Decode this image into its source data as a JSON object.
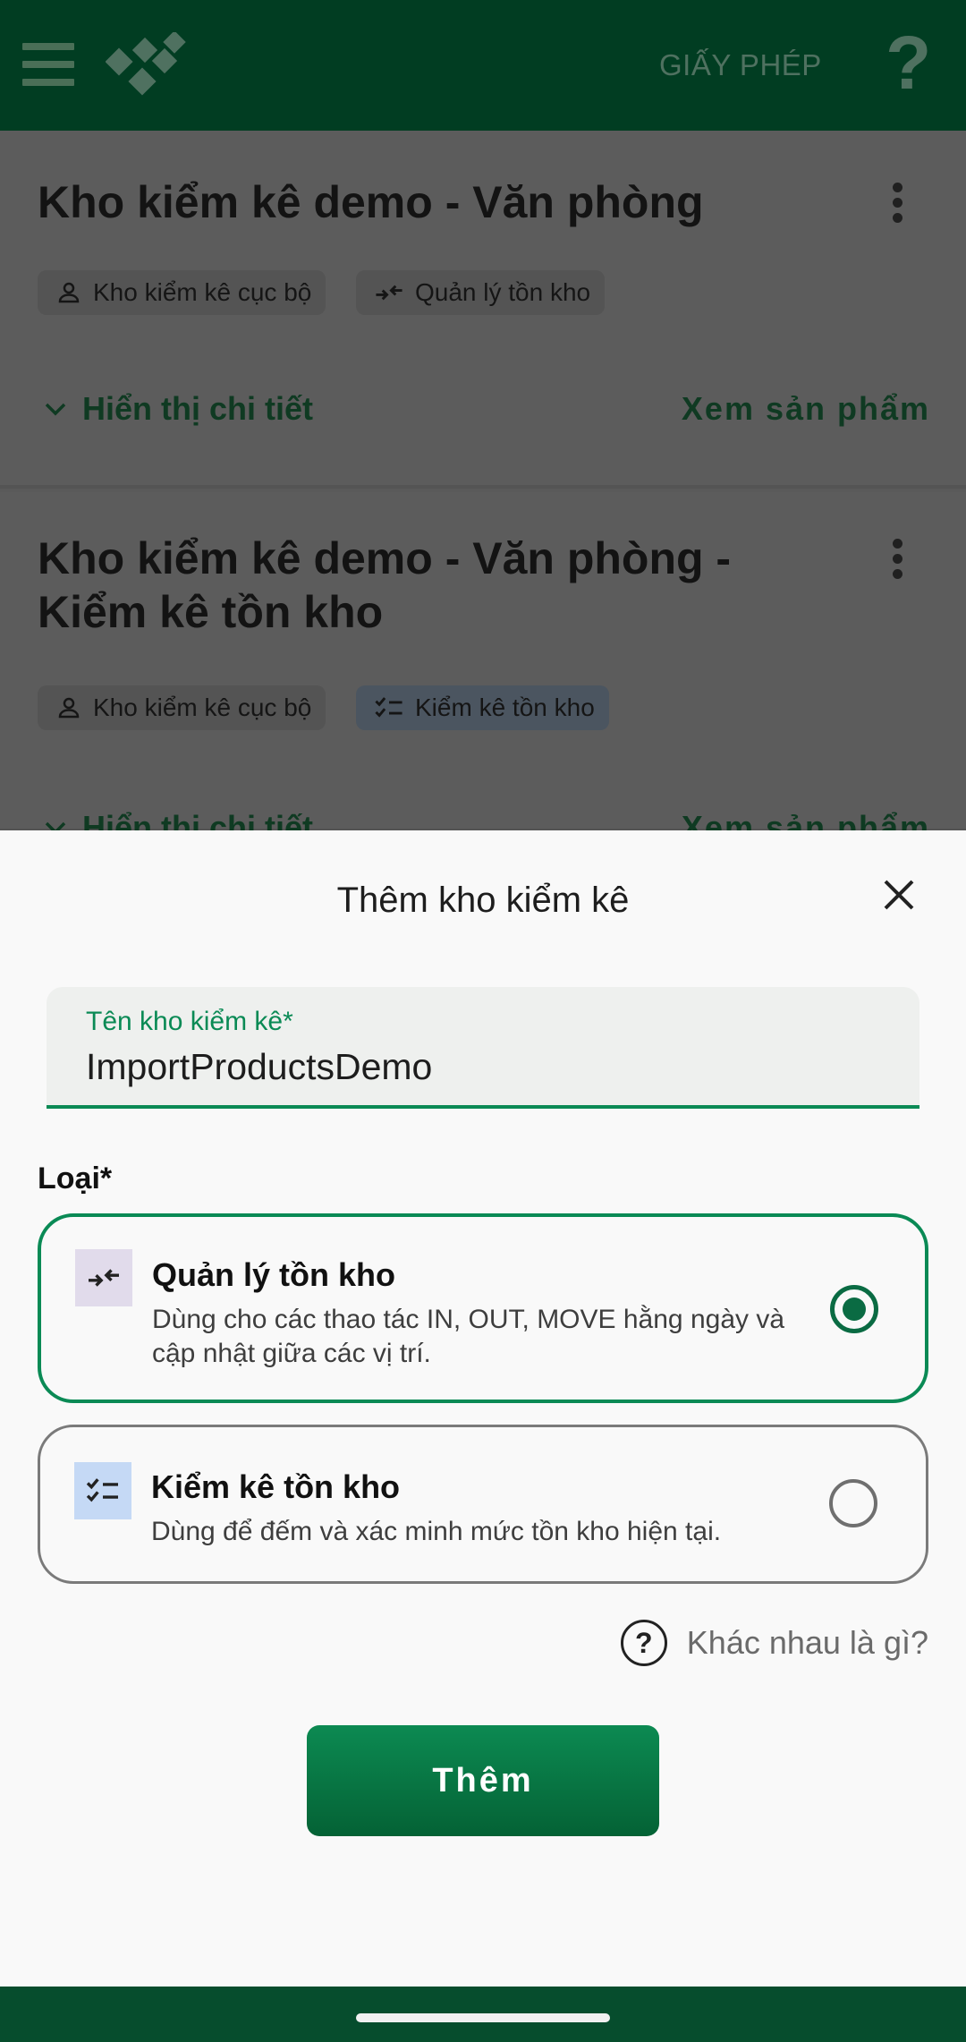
{
  "appbar": {
    "license_label": "GIẤY PHÉP",
    "help_label": "?"
  },
  "cards": [
    {
      "title": "Kho kiểm kê demo - Văn phòng",
      "chips": [
        "Kho kiểm kê cục bộ",
        "Quản lý tồn kho"
      ],
      "details_label": "Hiển thị chi tiết",
      "view_products_label": "Xem sản phẩm"
    },
    {
      "title_line1": "Kho kiểm kê demo - Văn phòng -",
      "title_line2": "Kiểm kê tồn kho",
      "chips": [
        "Kho kiểm kê cục bộ",
        "Kiểm kê tồn kho"
      ],
      "details_label": "Hiển thị chi tiết",
      "view_products_label": "Xem sản phẩm"
    }
  ],
  "sheet": {
    "title": "Thêm kho kiểm kê",
    "name_field": {
      "label": "Tên kho kiểm kê*",
      "value": "ImportProductsDemo"
    },
    "type_label": "Loại*",
    "options": [
      {
        "title": "Quản lý tồn kho",
        "desc": "Dùng cho các thao tác IN, OUT, MOVE hằng ngày và cập nhật giữa các vị trí.",
        "selected": true
      },
      {
        "title": "Kiểm kê tồn kho",
        "desc": "Dùng để đếm và xác minh mức tồn kho hiện tại.",
        "selected": false
      }
    ],
    "help_icon": "?",
    "help_label": "Khác nhau là gì?",
    "submit_label": "Thêm"
  },
  "colors": {
    "primary": "#0a8a55",
    "appbar": "#013d22",
    "navbar": "#064d2d"
  }
}
